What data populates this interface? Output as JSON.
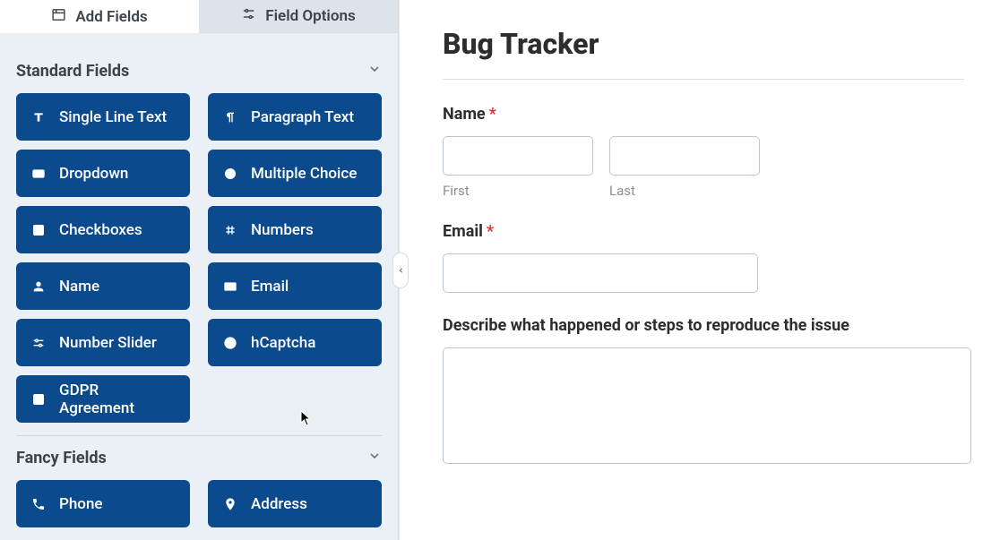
{
  "tabs": {
    "add_fields": "Add Fields",
    "field_options": "Field Options"
  },
  "sections": {
    "standard": {
      "title": "Standard Fields",
      "fields": {
        "single_line_text": "Single Line Text",
        "paragraph_text": "Paragraph Text",
        "dropdown": "Dropdown",
        "multiple_choice": "Multiple Choice",
        "checkboxes": "Checkboxes",
        "numbers": "Numbers",
        "name": "Name",
        "email": "Email",
        "number_slider": "Number Slider",
        "hcaptcha": "hCaptcha",
        "gdpr": "GDPR Agreement"
      }
    },
    "fancy": {
      "title": "Fancy Fields",
      "fields": {
        "phone": "Phone",
        "address": "Address"
      }
    }
  },
  "form": {
    "title": "Bug Tracker",
    "name_label": "Name",
    "first_label": "First",
    "last_label": "Last",
    "email_label": "Email",
    "describe_label": "Describe what happened or steps to reproduce the issue",
    "required_marker": "*"
  }
}
